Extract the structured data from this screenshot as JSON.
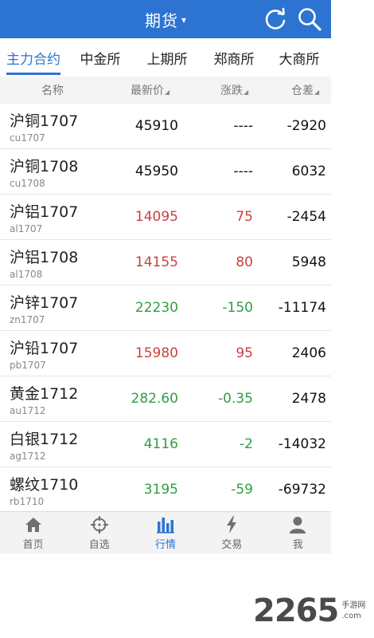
{
  "header": {
    "title": "期货",
    "caret": "▾",
    "refresh_icon": "refresh-icon",
    "search_icon": "search-icon"
  },
  "tabs": [
    {
      "label": "主力合约",
      "active": true
    },
    {
      "label": "中金所",
      "active": false
    },
    {
      "label": "上期所",
      "active": false
    },
    {
      "label": "郑商所",
      "active": false
    },
    {
      "label": "大商所",
      "active": false
    }
  ],
  "columns": {
    "name": "名称",
    "price": "最新价",
    "change": "涨跌",
    "oi_change": "仓差",
    "sort_marker": "◢"
  },
  "colors": {
    "accent": "#2d74d2",
    "up": "#c8423f",
    "down": "#2f9e44",
    "flat": "#111111"
  },
  "rows": [
    {
      "name": "沪铜1707",
      "code": "cu1707",
      "price": "45910",
      "change": "----",
      "oi_change": "-2920",
      "direction": "flat"
    },
    {
      "name": "沪铜1708",
      "code": "cu1708",
      "price": "45950",
      "change": "----",
      "oi_change": "6032",
      "direction": "flat"
    },
    {
      "name": "沪铝1707",
      "code": "al1707",
      "price": "14095",
      "change": "75",
      "oi_change": "-2454",
      "direction": "up"
    },
    {
      "name": "沪铝1708",
      "code": "al1708",
      "price": "14155",
      "change": "80",
      "oi_change": "5948",
      "direction": "up"
    },
    {
      "name": "沪锌1707",
      "code": "zn1707",
      "price": "22230",
      "change": "-150",
      "oi_change": "-11174",
      "direction": "down"
    },
    {
      "name": "沪铅1707",
      "code": "pb1707",
      "price": "15980",
      "change": "95",
      "oi_change": "2406",
      "direction": "up"
    },
    {
      "name": "黄金1712",
      "code": "au1712",
      "price": "282.60",
      "change": "-0.35",
      "oi_change": "2478",
      "direction": "down"
    },
    {
      "name": "白银1712",
      "code": "ag1712",
      "price": "4116",
      "change": "-2",
      "oi_change": "-14032",
      "direction": "down"
    },
    {
      "name": "螺纹1710",
      "code": "rb1710",
      "price": "3195",
      "change": "-59",
      "oi_change": "-69732",
      "direction": "down"
    }
  ],
  "bottom_nav": [
    {
      "label": "首页",
      "icon": "home-icon",
      "active": false
    },
    {
      "label": "自选",
      "icon": "crosshair-icon",
      "active": false
    },
    {
      "label": "行情",
      "icon": "bar-chart-icon",
      "active": true
    },
    {
      "label": "交易",
      "icon": "lightning-icon",
      "active": false
    },
    {
      "label": "我",
      "icon": "user-icon",
      "active": false
    }
  ],
  "watermark": {
    "number": "2265",
    "line1": "手游网",
    "line2": ".com"
  }
}
